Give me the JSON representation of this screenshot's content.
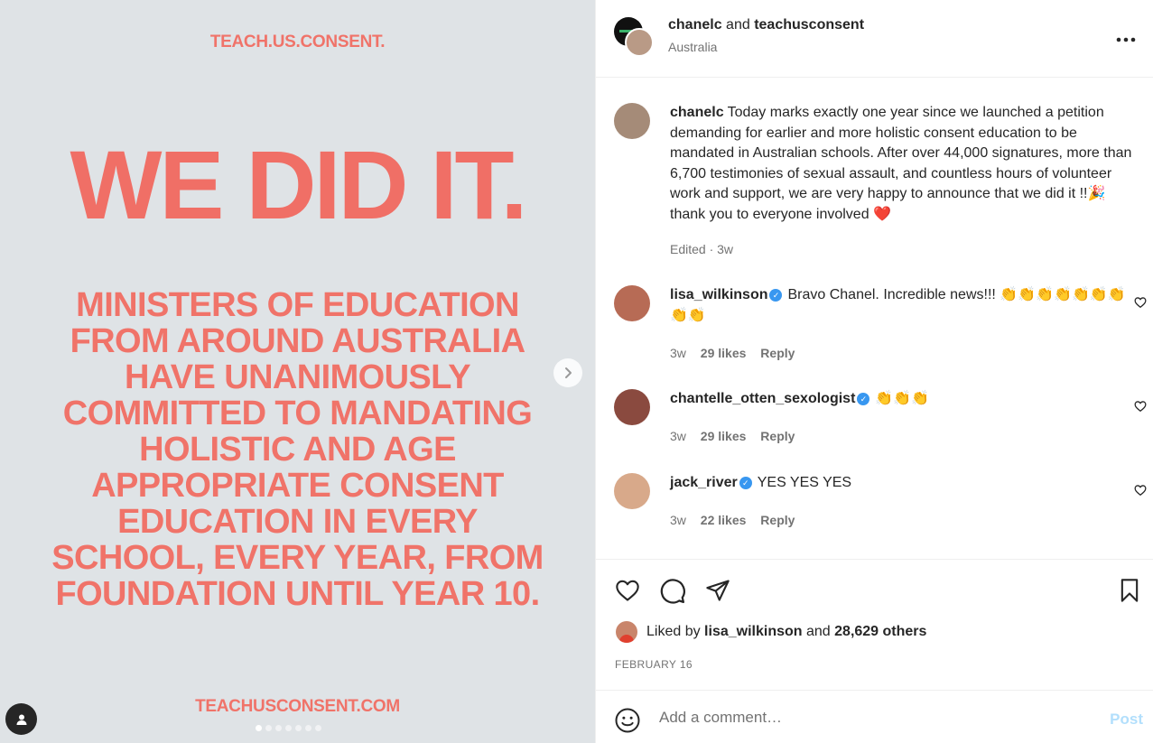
{
  "media": {
    "brand_top": "TEACH.US.CONSENT.",
    "headline": "WE DID IT.",
    "body_lines": [
      "MINISTERS OF EDUCATION",
      "FROM AROUND AUSTRALIA",
      "HAVE UNANIMOUSLY",
      "COMMITTED TO MANDATING",
      "HOLISTIC AND AGE",
      "APPROPRIATE CONSENT",
      "EDUCATION IN EVERY",
      "SCHOOL, EVERY YEAR, FROM",
      "FOUNDATION UNTIL YEAR 10."
    ],
    "brand_bottom": "TEACHUSCONSENT.COM",
    "slide_count": 7,
    "active_slide": 1
  },
  "header": {
    "user1": "chanelc",
    "joiner": "and",
    "user2": "teachusconsent",
    "location": "Australia",
    "more_icon": "more-horizontal-icon"
  },
  "caption": {
    "username": "chanelc",
    "text": "Today marks exactly one year since we launched a petition demanding for earlier and more holistic consent education to be mandated in Australian schools. After over 44,000 signatures, more than 6,700 testimonies of sexual assault, and countless hours of volunteer work and support, we are very happy to announce that we did it !!🎉 thank you to everyone involved ❤️",
    "meta": "Edited · 3w"
  },
  "comments": [
    {
      "username": "lisa_wilkinson",
      "verified": true,
      "text": "Bravo Chanel. Incredible news!!! 👏👏👏👏👏👏👏👏👏",
      "time": "3w",
      "likes": "29 likes",
      "reply": "Reply"
    },
    {
      "username": "chantelle_otten_sexologist",
      "verified": true,
      "text": "👏👏👏",
      "time": "3w",
      "likes": "29 likes",
      "reply": "Reply"
    },
    {
      "username": "jack_river",
      "verified": true,
      "text": "YES YES YES",
      "time": "3w",
      "likes": "22 likes",
      "reply": "Reply"
    }
  ],
  "actions": {
    "liked_prefix": "Liked by",
    "liked_user": "lisa_wilkinson",
    "liked_and": "and",
    "liked_others": "28,629 others",
    "date": "FEBRUARY 16"
  },
  "add_comment": {
    "placeholder": "Add a comment…",
    "post_label": "Post"
  },
  "colors": {
    "accent_coral": "#f06f66",
    "media_bg": "#dfe3e6",
    "verified_blue": "#3897f0",
    "post_disabled": "#b2dffc"
  }
}
